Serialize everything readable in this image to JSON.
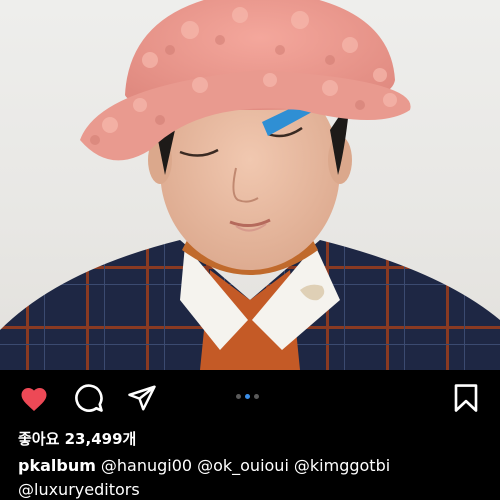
{
  "post": {
    "image_alt": "Portrait of a person wearing a fuzzy pink bucket hat and plaid blazer"
  },
  "actions": {
    "like_icon": "heart-filled-icon",
    "comment_icon": "comment-bubble-icon",
    "share_icon": "paper-plane-icon",
    "save_icon": "bookmark-icon",
    "like_color": "#ed4956"
  },
  "carousel": {
    "count": 3,
    "active_index": 1,
    "active_color": "#3b8ee8"
  },
  "likes": {
    "text": "좋아요 23,499개"
  },
  "caption": {
    "username": "pkalbum",
    "mentions": [
      "@hanugi00",
      "@ok_ouioui",
      "@kimggotbi",
      "@luxuryeditors"
    ]
  }
}
